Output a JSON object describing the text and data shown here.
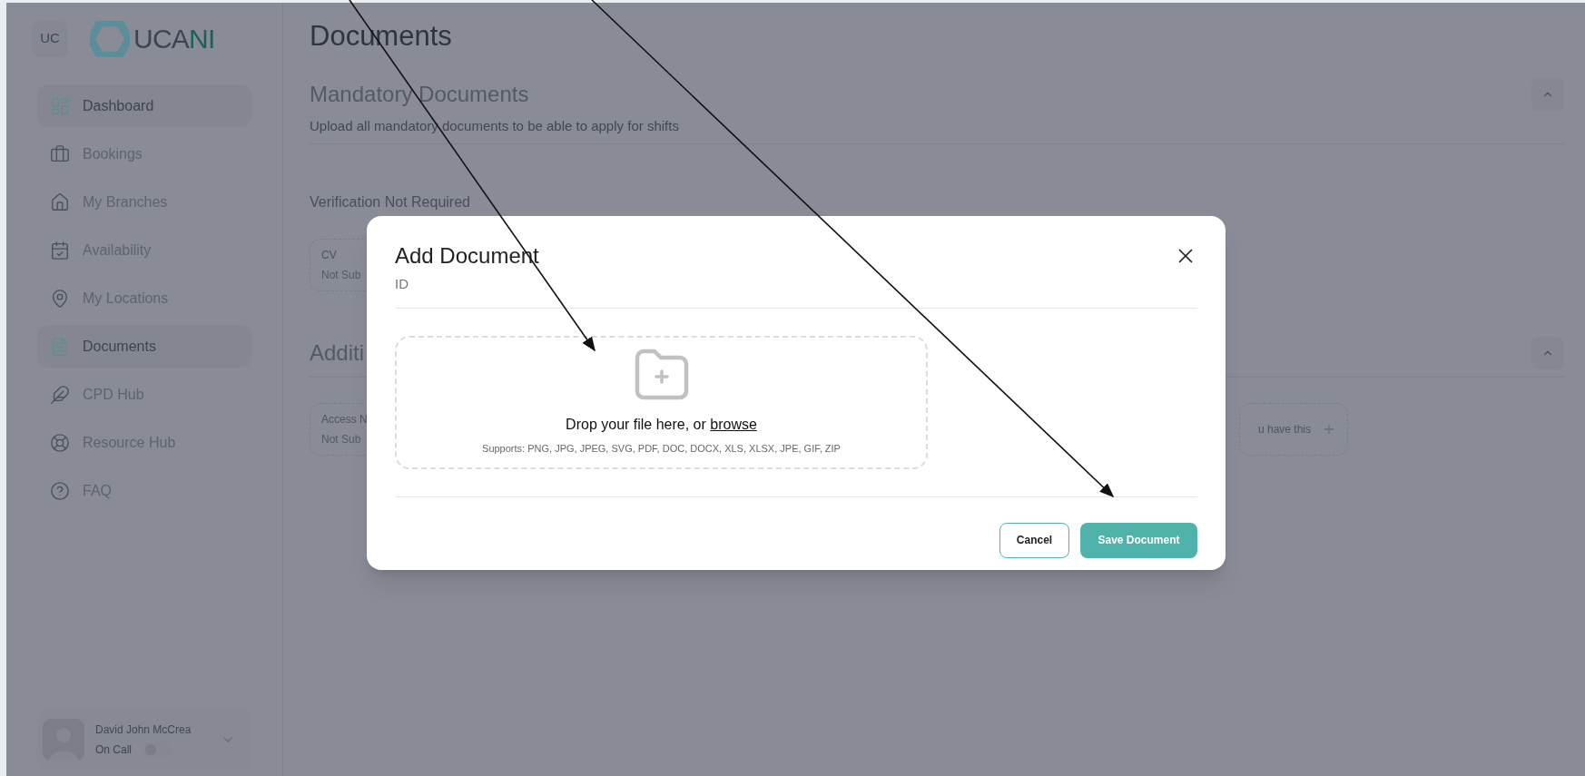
{
  "sidebar": {
    "badge": "UC",
    "logo": {
      "main": "UCA",
      "accent": "NI"
    },
    "items": [
      {
        "label": "Dashboard",
        "selected": true
      },
      {
        "label": "Bookings",
        "selected": false
      },
      {
        "label": "My Branches",
        "selected": false
      },
      {
        "label": "Availability",
        "selected": false
      },
      {
        "label": "My Locations",
        "selected": false
      },
      {
        "label": "Documents",
        "selected": true
      },
      {
        "label": "CPD Hub",
        "selected": false
      },
      {
        "label": "Resource Hub",
        "selected": false
      },
      {
        "label": "FAQ",
        "selected": false
      }
    ],
    "user": {
      "name": "David John McCrea",
      "status": "On Call",
      "on": false
    }
  },
  "main": {
    "title": "Documents",
    "sections": [
      {
        "title": "Mandatory Documents",
        "subtitle": "Upload all mandatory documents to be able to apply for shifts",
        "expanded": true,
        "group_label": "Verification Not Required",
        "cards": [
          {
            "title": "CV",
            "status": "Not Sub"
          }
        ]
      },
      {
        "title": "Additi",
        "expanded": true,
        "cards": [
          {
            "title": "Access N",
            "status": "Not Sub"
          }
        ],
        "right_card": {
          "text": "u have this"
        }
      }
    ]
  },
  "modal": {
    "title": "Add Document",
    "subtitle": "ID",
    "dropzone": {
      "text": "Drop your file here, or ",
      "link": "browse",
      "supports": "Supports: PNG, JPG, JPEG, SVG, PDF, DOC, DOCX, XLS, XLSX, JPE, GIF, ZIP"
    },
    "buttons": [
      {
        "label": "Cancel",
        "kind": "secondary"
      },
      {
        "label": "Save Document",
        "kind": "primary"
      }
    ]
  }
}
